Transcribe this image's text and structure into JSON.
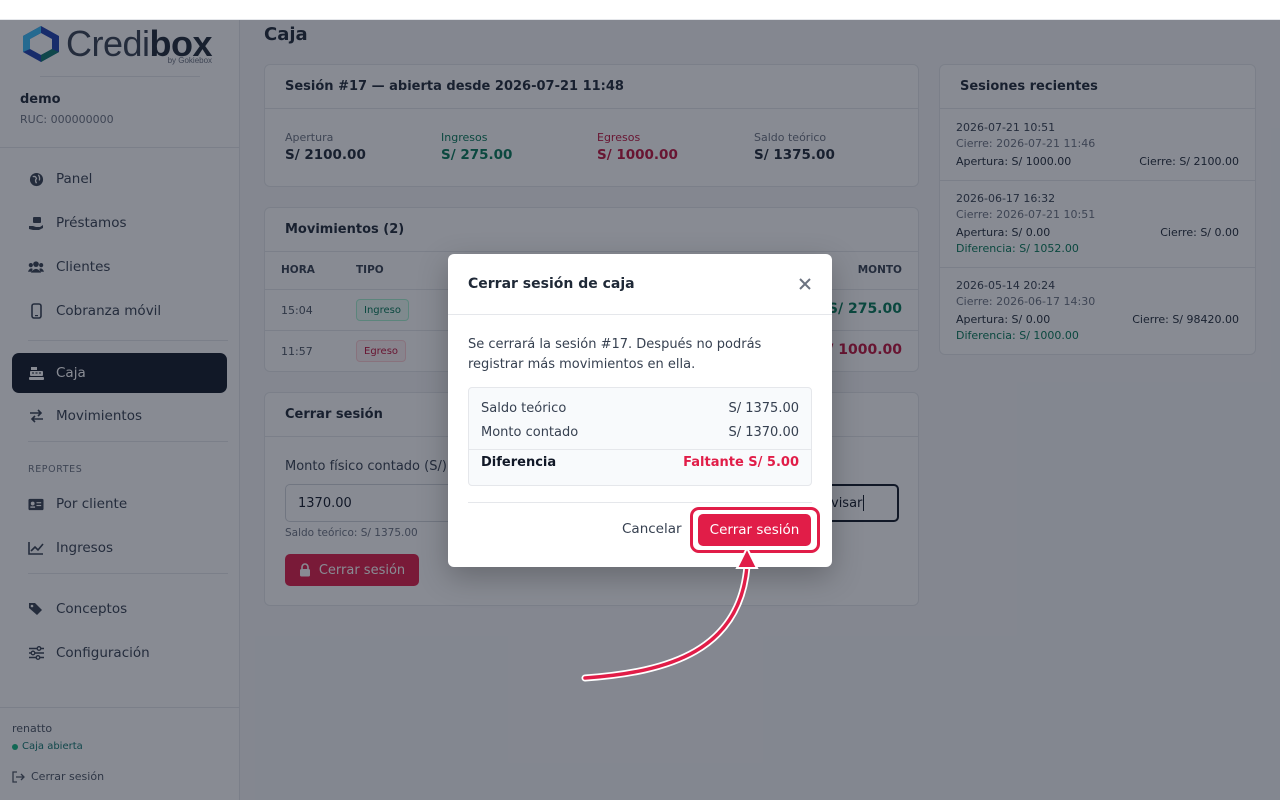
{
  "brand": {
    "name_light": "Credi",
    "name_bold": "box",
    "sub": "by Gokiebox"
  },
  "company": {
    "name": "demo",
    "ruc": "RUC: 000000000"
  },
  "nav": {
    "items": [
      {
        "label": "Panel",
        "icon": "globe-icon"
      },
      {
        "label": "Préstamos",
        "icon": "hand-money-icon"
      },
      {
        "label": "Clientes",
        "icon": "users-icon"
      },
      {
        "label": "Cobranza móvil",
        "icon": "mobile-icon"
      },
      {
        "label": "Caja",
        "icon": "cash-register-icon",
        "active": true
      },
      {
        "label": "Movimientos",
        "icon": "arrows-exchange-icon"
      }
    ],
    "section_reports": "REPORTES",
    "reports": [
      {
        "label": "Por cliente",
        "icon": "id-card-icon"
      },
      {
        "label": "Ingresos",
        "icon": "line-chart-icon"
      }
    ],
    "extra": [
      {
        "label": "Conceptos",
        "icon": "tags-icon"
      },
      {
        "label": "Configuración",
        "icon": "sliders-icon"
      }
    ]
  },
  "user": {
    "name": "renatto",
    "status": "Caja abierta",
    "logout": "Cerrar sesión"
  },
  "page": {
    "title": "Caja"
  },
  "session": {
    "title": "Sesión #17 — abierta desde 2026-07-21 11:48",
    "stats": [
      {
        "label": "Apertura",
        "value": "S/ 2100.00"
      },
      {
        "label": "Ingresos",
        "value": "S/ 275.00"
      },
      {
        "label": "Egresos",
        "value": "S/ 1000.00"
      },
      {
        "label": "Saldo teórico",
        "value": "S/ 1375.00"
      }
    ]
  },
  "movements": {
    "title": "Movimientos (2)",
    "columns": {
      "hora": "HORA",
      "tipo": "TIPO",
      "monto": "MONTO"
    },
    "rows": [
      {
        "time": "15:04",
        "type": "Ingreso",
        "amount": "S/ 275.00",
        "amount_prefix": "+"
      },
      {
        "time": "11:57",
        "type": "Egreso",
        "amount": "S/ 1000.00",
        "amount_prefix": "−"
      }
    ]
  },
  "close_session": {
    "title": "Cerrar sesión",
    "field_label": "Monto físico contado (S/)",
    "field_value": "1370.00",
    "notes_value": "visar",
    "hint": "Saldo teórico: S/ 1375.00",
    "button": "Cerrar sesión"
  },
  "recent": {
    "title": "Sesiones recientes",
    "items": [
      {
        "date": "2026-07-21 10:51",
        "close": "Cierre: 2026-07-21 11:46",
        "opening": "Apertura: S/ 1000.00",
        "closing": "Cierre: S/ 2100.00",
        "diff": ""
      },
      {
        "date": "2026-06-17 16:32",
        "close": "Cierre: 2026-07-21 10:51",
        "opening": "Apertura: S/ 0.00",
        "closing": "Cierre: S/ 0.00",
        "diff": "Diferencia: S/ 1052.00"
      },
      {
        "date": "2026-05-14 20:24",
        "close": "Cierre: 2026-06-17 14:30",
        "opening": "Apertura: S/ 0.00",
        "closing": "Cierre: S/ 98420.00",
        "diff": "Diferencia: S/ 1000.00"
      }
    ]
  },
  "modal": {
    "title": "Cerrar sesión de caja",
    "text": "Se cerrará la sesión #17. Después no podrás registrar más movimientos en ella.",
    "rows": [
      {
        "label": "Saldo teórico",
        "value": "S/ 1375.00"
      },
      {
        "label": "Monto contado",
        "value": "S/ 1370.00"
      }
    ],
    "diff_label": "Diferencia",
    "diff_value": "Faltante S/ 5.00",
    "cancel": "Cancelar",
    "confirm": "Cerrar sesión"
  },
  "colors": {
    "primary_dark": "#111827",
    "danger": "#e11d48",
    "success": "#047857"
  }
}
